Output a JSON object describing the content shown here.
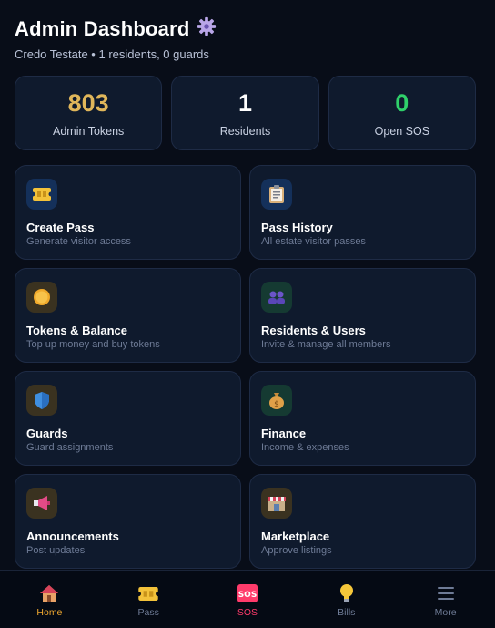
{
  "header": {
    "title": "Admin Dashboard",
    "subtitle": "Credo Testate • 1 residents, 0 guards",
    "title_icon": "gear-icon"
  },
  "stats": [
    {
      "value": "803",
      "label": "Admin Tokens",
      "color": "#e0b65a"
    },
    {
      "value": "1",
      "label": "Residents",
      "color": "#ffffff"
    },
    {
      "value": "0",
      "label": "Open SOS",
      "color": "#2fd06a"
    }
  ],
  "cards": [
    {
      "title": "Create Pass",
      "desc": "Generate visitor access",
      "icon": "ticket-icon",
      "icon_bg": "#14305a"
    },
    {
      "title": "Pass History",
      "desc": "All estate visitor passes",
      "icon": "clipboard-icon",
      "icon_bg": "#14305a"
    },
    {
      "title": "Tokens & Balance",
      "desc": "Top up money and buy tokens",
      "icon": "coin-icon",
      "icon_bg": "#3a3220"
    },
    {
      "title": "Residents & Users",
      "desc": "Invite & manage all members",
      "icon": "users-icon",
      "icon_bg": "#153a32"
    },
    {
      "title": "Guards",
      "desc": "Guard assignments",
      "icon": "shield-icon",
      "icon_bg": "#3a3220"
    },
    {
      "title": "Finance",
      "desc": "Income & expenses",
      "icon": "money-bag-icon",
      "icon_bg": "#153a32"
    },
    {
      "title": "Announcements",
      "desc": "Post updates",
      "icon": "megaphone-icon",
      "icon_bg": "#3a3220"
    },
    {
      "title": "Marketplace",
      "desc": "Approve listings",
      "icon": "store-icon",
      "icon_bg": "#3a3220"
    }
  ],
  "nav": [
    {
      "label": "Home",
      "icon": "home-icon",
      "active": true,
      "color": "#f0a830"
    },
    {
      "label": "Pass",
      "icon": "ticket-icon",
      "active": false,
      "color": "#6e7b96"
    },
    {
      "label": "SOS",
      "icon": "sos-icon",
      "active": false,
      "color": "#ff3b6b"
    },
    {
      "label": "Bills",
      "icon": "lightbulb-icon",
      "active": false,
      "color": "#6e7b96"
    },
    {
      "label": "More",
      "icon": "menu-icon",
      "active": false,
      "color": "#6e7b96"
    }
  ]
}
